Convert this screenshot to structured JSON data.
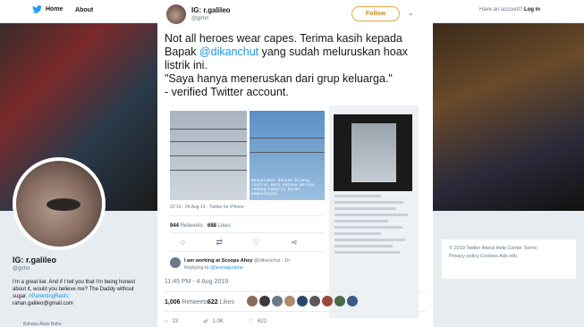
{
  "nav": {
    "home": "Home",
    "about": "About",
    "account_prompt": "Have an account?",
    "login": "Log in"
  },
  "profile": {
    "name": "IG: r.galileo",
    "handle": "@glrhn",
    "bio": "I'm a great liar. And if I tell you that I'm being honest about it, would you believe me? The Daddy without sugar.",
    "bio_tag": "#ParentingRants",
    "email": "rahan.galileo@gmail.com",
    "location": "Bahasa Akan Bahu"
  },
  "footer": {
    "line1": "© 2019 Twitter  About  Help Center  Terms",
    "line2": "Privacy policy  Cookies  Ads info"
  },
  "tweet": {
    "name": "IG: r.galileo",
    "handle": "@glrhn",
    "follow": "Follow",
    "text_before": "Not all heroes wear capes. Terima kasih kepada Bapak ",
    "mention": "@dikanchut",
    "text_after": " yang sudah meluruskan hoax listrik ini.",
    "quote": "\"Saya hanya meneruskan dari grup keluarga.\"",
    "sig": "- verified Twitter account.",
    "media_caption": "Masyarakat banyak bilang listrik mati karena mereka sedang bekerja keras memperbaiki",
    "embed_time": "22:19 · 04 Aug 19 · Twitter for iPhone",
    "embed_retweets_num": "944",
    "embed_retweets_label": "Retweets",
    "embed_likes_num": "688",
    "embed_likes_label": "Likes",
    "reply_author": "I am working at Scoops Ahoy",
    "reply_handle": "@dikanchut · 1h",
    "reply_to_label": "Replying to",
    "reply_to": "@leonagustine",
    "timestamp": "11:45 PM - 4 Aug 2019",
    "retweets_num": "1,006",
    "retweets_label": "Retweets",
    "likes_num": "622",
    "likes_label": "Likes",
    "replies_count": "23",
    "rt_count": "1.0K",
    "like_count": "622"
  },
  "colors": {
    "accent": "#1b95e0",
    "follow": "#e0ac43",
    "background": "#e6ecf0"
  }
}
